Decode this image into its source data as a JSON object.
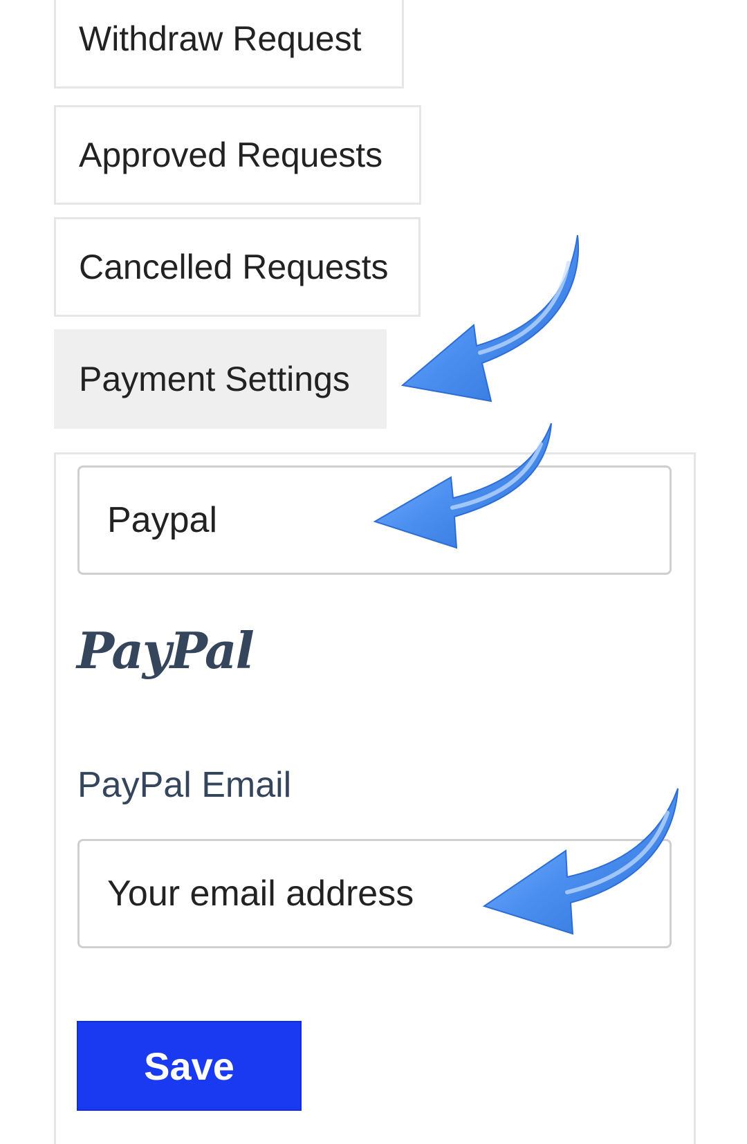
{
  "tabs": {
    "withdraw": "Withdraw Request",
    "approved": "Approved Requests",
    "cancelled": "Cancelled Requests",
    "payment_settings": "Payment Settings",
    "active": "payment_settings"
  },
  "payment": {
    "method_selected": "Paypal",
    "logo_text": "PayPal",
    "email_label": "PayPal Email",
    "email_placeholder": "Your email address",
    "save_label": "Save"
  },
  "annotations": {
    "arrow_icon": "blue-curved-arrow-icon",
    "arrow_color": "#3f86ee"
  }
}
